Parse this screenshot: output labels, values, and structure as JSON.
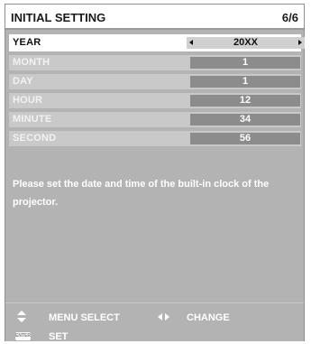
{
  "header": {
    "title": "INITIAL SETTING",
    "page_indicator": "6/6"
  },
  "rows": [
    {
      "label": "YEAR",
      "value": "20XX",
      "selected": true
    },
    {
      "label": "MONTH",
      "value": "1"
    },
    {
      "label": "DAY",
      "value": "1"
    },
    {
      "label": "HOUR",
      "value": "12"
    },
    {
      "label": "MINUTE",
      "value": "34"
    },
    {
      "label": "SECOND",
      "value": "56"
    }
  ],
  "message": "Please set the date and time of the built-in clock of the projector.",
  "footer": {
    "menu_select_label": "MENU SELECT",
    "change_label": "CHANGE",
    "enter_icon_text": "ENTER",
    "set_label": "SET"
  },
  "colors": {
    "panel_bg": "#b3b3b3",
    "row_bg": "#c9c9c9",
    "value_bg": "#8c8c8c",
    "selected_row_bg": "#ffffff"
  }
}
